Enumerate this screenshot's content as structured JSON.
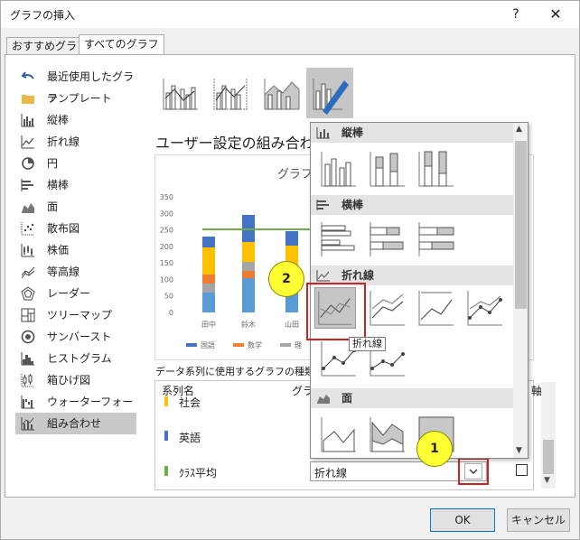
{
  "window": {
    "title": "グラフの挿入",
    "help": "?",
    "close": "✕"
  },
  "tabs": [
    {
      "label": "おすすめグラフ"
    },
    {
      "label": "すべてのグラフ"
    }
  ],
  "sidebar": {
    "items": [
      {
        "label": "最近使用したグラフ",
        "icon": "undo-icon"
      },
      {
        "label": "テンプレート",
        "icon": "folder-icon"
      },
      {
        "label": "縦棒",
        "icon": "column-chart-icon"
      },
      {
        "label": "折れ線",
        "icon": "line-chart-icon"
      },
      {
        "label": "円",
        "icon": "pie-chart-icon"
      },
      {
        "label": "横棒",
        "icon": "bar-chart-icon"
      },
      {
        "label": "面",
        "icon": "area-chart-icon"
      },
      {
        "label": "散布図",
        "icon": "scatter-chart-icon"
      },
      {
        "label": "株価",
        "icon": "stock-chart-icon"
      },
      {
        "label": "等高線",
        "icon": "surface-chart-icon"
      },
      {
        "label": "レーダー",
        "icon": "radar-chart-icon"
      },
      {
        "label": "ツリーマップ",
        "icon": "treemap-icon"
      },
      {
        "label": "サンバースト",
        "icon": "sunburst-icon"
      },
      {
        "label": "ヒストグラム",
        "icon": "histogram-icon"
      },
      {
        "label": "箱ひげ図",
        "icon": "box-whisker-icon"
      },
      {
        "label": "ウォーターフォール",
        "icon": "waterfall-icon"
      },
      {
        "label": "組み合わせ",
        "icon": "combo-chart-icon",
        "active": true
      }
    ]
  },
  "main": {
    "section_title": "ユーザー設定の組み合わせ",
    "preview_title": "グラフ",
    "caption": "データ系列に使用するグラフの種類と"
  },
  "preview": {
    "y_ticks": [
      "350",
      "300",
      "250",
      "200",
      "150",
      "100",
      "50",
      "0"
    ],
    "categories": [
      "田中",
      "鈴木",
      "山田"
    ],
    "legend": [
      "国語",
      "数学",
      "理"
    ],
    "colors": {
      "kokugo": "#4472c4",
      "sugaku": "#ed7d31",
      "ri": "#a5a5a5",
      "shakai": "#ffc000",
      "eigo": "#5b9bd5",
      "avg": "#70ad47"
    }
  },
  "series_table": {
    "headers": {
      "name": "系列名",
      "type": "グラ",
      "axis": "軸"
    },
    "rows": [
      {
        "name": "社会",
        "color": "#ffc000"
      },
      {
        "name": "英語",
        "color": "#4472c4"
      },
      {
        "name": "ｸﾗｽ平均",
        "color": "#70ad47",
        "type": "折れ線"
      }
    ]
  },
  "dropdown": {
    "groups": [
      {
        "label": "縦棒"
      },
      {
        "label": "横棒"
      },
      {
        "label": "折れ線"
      },
      {
        "label": "面"
      }
    ],
    "tooltip": "折れ線",
    "scroll_up": "▲",
    "scroll_down": "▼"
  },
  "callouts": {
    "one": "1",
    "two": "2"
  },
  "buttons": {
    "ok": "OK",
    "cancel": "キャンセル"
  }
}
